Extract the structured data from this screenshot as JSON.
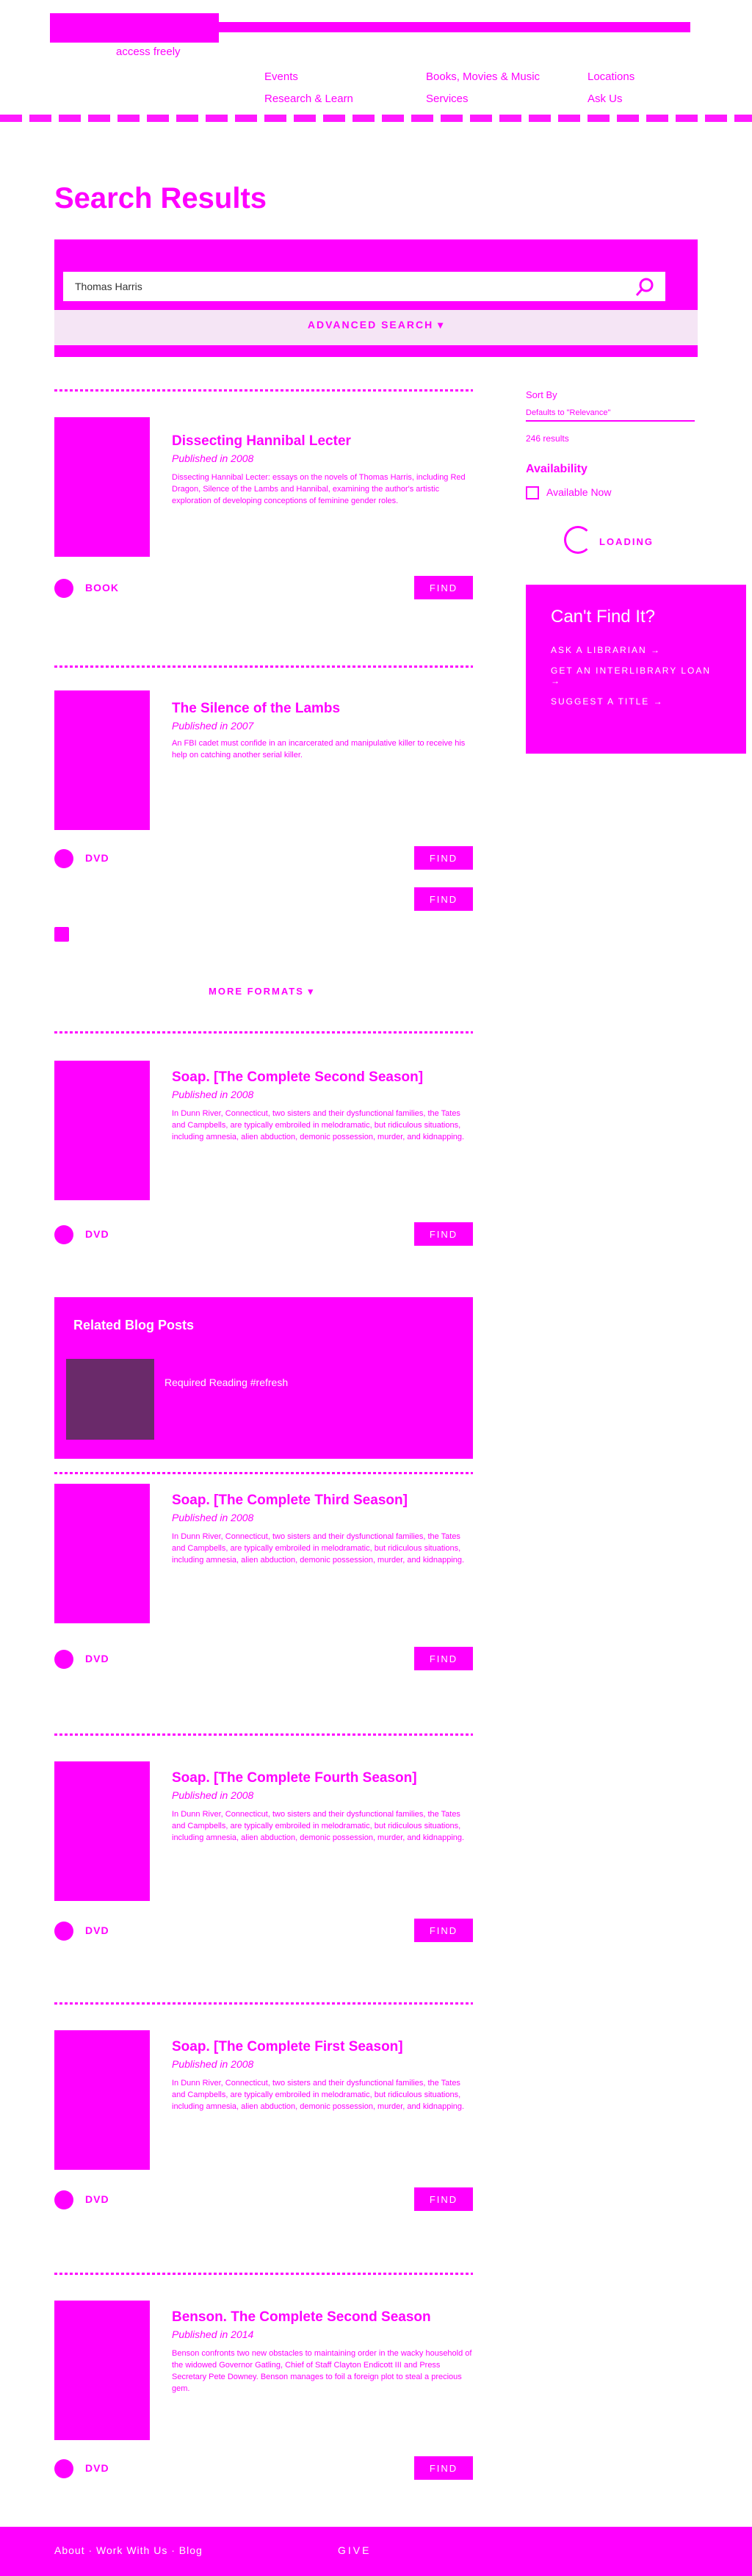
{
  "header": {
    "tagline": "access freely",
    "nav": [
      {
        "label": "Events"
      },
      {
        "label": "Books, Movies & Music"
      },
      {
        "label": "Locations"
      },
      {
        "label": "Research & Learn"
      },
      {
        "label": "Services"
      },
      {
        "label": "Ask Us"
      }
    ]
  },
  "page_title": "Search Results",
  "search": {
    "value": "Thomas Harris",
    "advanced_label": "ADVANCED SEARCH ▾"
  },
  "sidebar": {
    "sort_label": "Sort By",
    "sort_value": "Defaults to \"Relevance\"",
    "count": "246 results",
    "availability_heading": "Availability",
    "availability_option": "Available Now",
    "loading": "LOADING"
  },
  "cant_find": {
    "heading": "Can't Find It?",
    "links": [
      "ASK A LIBRARIAN →",
      "GET AN INTERLIBRARY LOAN →",
      "SUGGEST A TITLE →"
    ]
  },
  "results": [
    {
      "title": "Dissecting Hannibal Lecter",
      "published": "Published in 2008",
      "description": "Dissecting Hannibal Lecter: essays on the novels of Thomas Harris, including Red Dragon, Silence of the Lambs and Hannibal, examining the author's artistic exploration of developing conceptions of feminine gender roles.",
      "formats": [
        {
          "label": "BOOK",
          "button": "FIND"
        }
      ]
    },
    {
      "title": "The Silence of the Lambs",
      "published": "Published in 2007",
      "description": "An FBI cadet must confide in an incarcerated and manipulative killer to receive his help on catching another serial killer.",
      "formats": [
        {
          "label": "DVD",
          "button": "FIND"
        },
        {
          "label": "",
          "button": "FIND"
        },
        {
          "label": "",
          "button": ""
        }
      ],
      "more": "MORE FORMATS ▾"
    },
    {
      "title": "Soap. [The Complete Second Season]",
      "published": "Published in 2008",
      "description": "In Dunn River, Connecticut, two sisters and their dysfunctional families, the Tates and Campbells, are typically embroiled in melodramatic, but ridiculous situations, including amnesia, alien abduction, demonic possession, murder, and kidnapping.",
      "formats": [
        {
          "label": "DVD",
          "button": "FIND"
        }
      ]
    },
    {
      "title": "Soap. [The Complete Third Season]",
      "published": "Published in 2008",
      "description": "In Dunn River, Connecticut, two sisters and their dysfunctional families, the Tates and Campbells, are typically embroiled in melodramatic, but ridiculous situations, including amnesia, alien abduction, demonic possession, murder, and kidnapping.",
      "formats": [
        {
          "label": "DVD",
          "button": "FIND"
        }
      ]
    },
    {
      "title": "Soap. [The Complete Fourth Season]",
      "published": "Published in 2008",
      "description": "In Dunn River, Connecticut, two sisters and their dysfunctional families, the Tates and Campbells, are typically embroiled in melodramatic, but ridiculous situations, including amnesia, alien abduction, demonic possession, murder, and kidnapping.",
      "formats": [
        {
          "label": "DVD",
          "button": "FIND"
        }
      ]
    },
    {
      "title": "Soap. [The Complete First Season]",
      "published": "Published in 2008",
      "description": "In Dunn River, Connecticut, two sisters and their dysfunctional families, the Tates and Campbells, are typically embroiled in melodramatic, but ridiculous situations, including amnesia, alien abduction, demonic possession, murder, and kidnapping.",
      "formats": [
        {
          "label": "DVD",
          "button": "FIND"
        }
      ]
    },
    {
      "title": "Benson. The Complete Second Season",
      "published": "Published in 2014",
      "description": "Benson confronts two new obstacles to maintaining order in the wacky household of the widowed Governor Gatling, Chief of Staff Clayton Endicott III and Press Secretary Pete Downey. Benson manages to foil a foreign plot to steal a precious gem.",
      "formats": [
        {
          "label": "DVD",
          "button": "FIND"
        }
      ]
    }
  ],
  "blog": {
    "heading": "Related Blog Posts",
    "link": "Required Reading #refresh"
  },
  "footer": {
    "left": "About · Work With Us · Blog",
    "give": "GIVE"
  }
}
